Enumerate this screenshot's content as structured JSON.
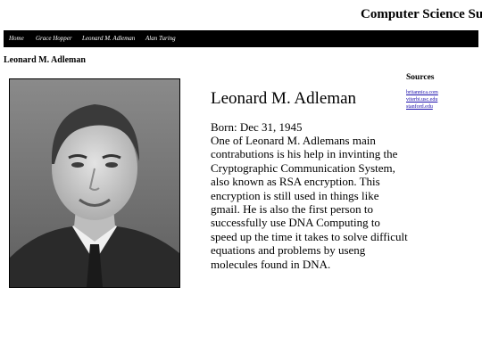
{
  "header": {
    "site_title": "Computer Science Supe"
  },
  "nav": {
    "items": [
      {
        "label": "Home"
      },
      {
        "label": "Grace Hopper"
      },
      {
        "label": "Leonard M. Adleman"
      },
      {
        "label": "Alan Turing"
      }
    ]
  },
  "page": {
    "heading": "Leonard M. Adleman"
  },
  "bio": {
    "title": "Leonard M. Adleman",
    "born": "Born: Dec 31, 1945",
    "body": "One of Leonard M. Adlemans main contrabutions is his help in invinting the Cryptographic Communication System, also known as RSA encryption. This encryption is still used in things like gmail. He is also the first person to successfully use DNA Computing to speed up the time it takes to solve difficult equations and problems by useng molecules found in DNA."
  },
  "sources": {
    "heading": "Sources",
    "links": [
      {
        "label": "britannica.com"
      },
      {
        "label": "viterbi.usc.edu"
      },
      {
        "label": "stanford.edu"
      }
    ]
  },
  "colors": {
    "nav_background": "#000000",
    "nav_text": "#ffffff",
    "link": "#1a0dab"
  }
}
